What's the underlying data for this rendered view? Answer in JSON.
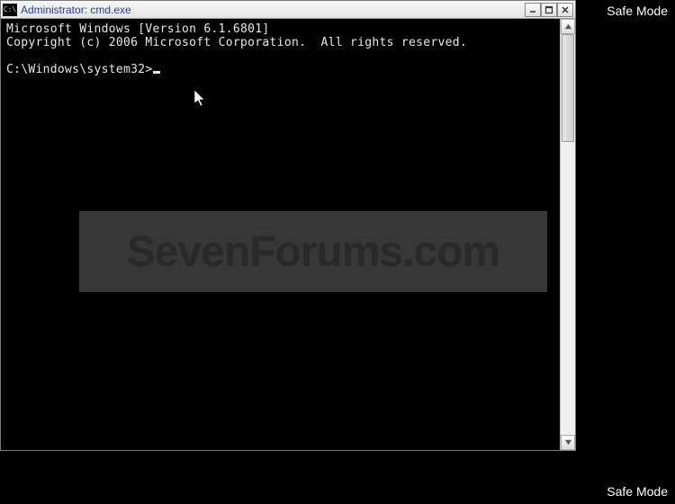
{
  "desktop": {
    "safe_mode_label": "Safe Mode"
  },
  "window": {
    "icon_text": "C:\\",
    "title": "Administrator: cmd.exe"
  },
  "terminal": {
    "line1": "Microsoft Windows [Version 6.1.6801]",
    "line2": "Copyright (c) 2006 Microsoft Corporation.  All rights reserved.",
    "blank": "",
    "prompt": "C:\\Windows\\system32>"
  },
  "watermark": {
    "text": "SevenForums.com"
  }
}
